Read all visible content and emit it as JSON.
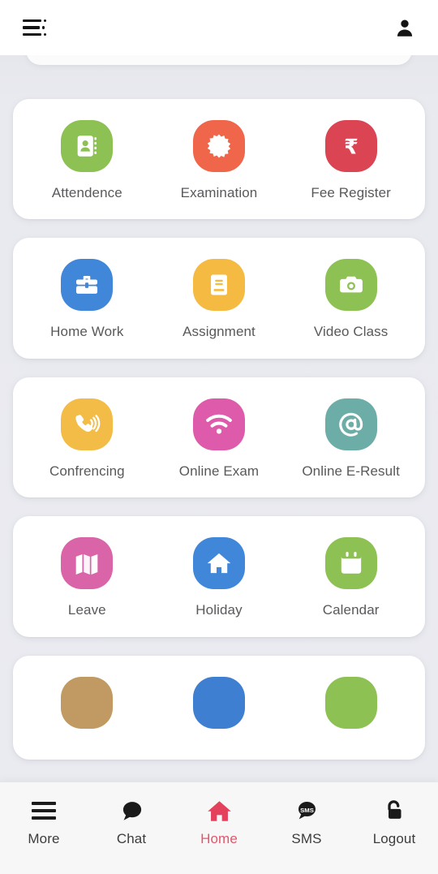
{
  "appbar": {
    "menu_icon": "hamburger-menu-icon",
    "profile_icon": "user-profile-icon"
  },
  "cards": [
    {
      "row_index": 1,
      "tiles": [
        {
          "label": "Attendence",
          "icon": "contact-book-icon",
          "color": "#8DC153"
        },
        {
          "label": "Examination",
          "icon": "starburst-icon",
          "color": "#F0664B"
        },
        {
          "label": "Fee Register",
          "icon": "rupee-icon",
          "color": "#DB4453"
        }
      ]
    },
    {
      "row_index": 2,
      "tiles": [
        {
          "label": "Home Work",
          "icon": "briefcase-icon",
          "color": "#4087D9"
        },
        {
          "label": "Assignment",
          "icon": "document-icon",
          "color": "#F5BA42"
        },
        {
          "label": "Video Class",
          "icon": "camera-icon",
          "color": "#8DC153"
        }
      ]
    },
    {
      "row_index": 3,
      "tiles": [
        {
          "label": "Confrencing",
          "icon": "phone-ringing-icon",
          "color": "#F3BC46"
        },
        {
          "label": "Online Exam",
          "icon": "wifi-icon",
          "color": "#DD5BAA"
        },
        {
          "label": "Online E-Result",
          "icon": "at-sign-icon",
          "color": "#6DADA8"
        }
      ]
    },
    {
      "row_index": 4,
      "tiles": [
        {
          "label": "Leave",
          "icon": "folded-map-icon",
          "color": "#D964A8"
        },
        {
          "label": "Holiday",
          "icon": "house-icon",
          "color": "#4087D9"
        },
        {
          "label": "Calendar",
          "icon": "calendar-icon",
          "color": "#8DC153"
        }
      ]
    },
    {
      "row_index": 5,
      "partially_visible": true,
      "tiles": [
        {
          "label": "",
          "icon": "partial-icon",
          "color": "#C09A62"
        },
        {
          "label": "",
          "icon": "partial-icon",
          "color": "#3F7FD1"
        },
        {
          "label": "",
          "icon": "partial-icon",
          "color": "#8DC153"
        }
      ]
    }
  ],
  "bottom_nav": {
    "active": "Home",
    "items": [
      {
        "label": "More",
        "icon": "hamburger-menu-icon",
        "active": false
      },
      {
        "label": "Chat",
        "icon": "chat-bubble-icon",
        "active": false
      },
      {
        "label": "Home",
        "icon": "home-house-icon",
        "active": true
      },
      {
        "label": "SMS",
        "icon": "sms-bubble-icon",
        "active": false
      },
      {
        "label": "Logout",
        "icon": "unlocked-padlock-icon",
        "active": false
      }
    ]
  },
  "theme": {
    "page_background": "#e9eaef",
    "card_background": "#ffffff",
    "label_color": "#59595c",
    "accent_color": "#e4556b",
    "nav_background": "#f7f7f8"
  }
}
